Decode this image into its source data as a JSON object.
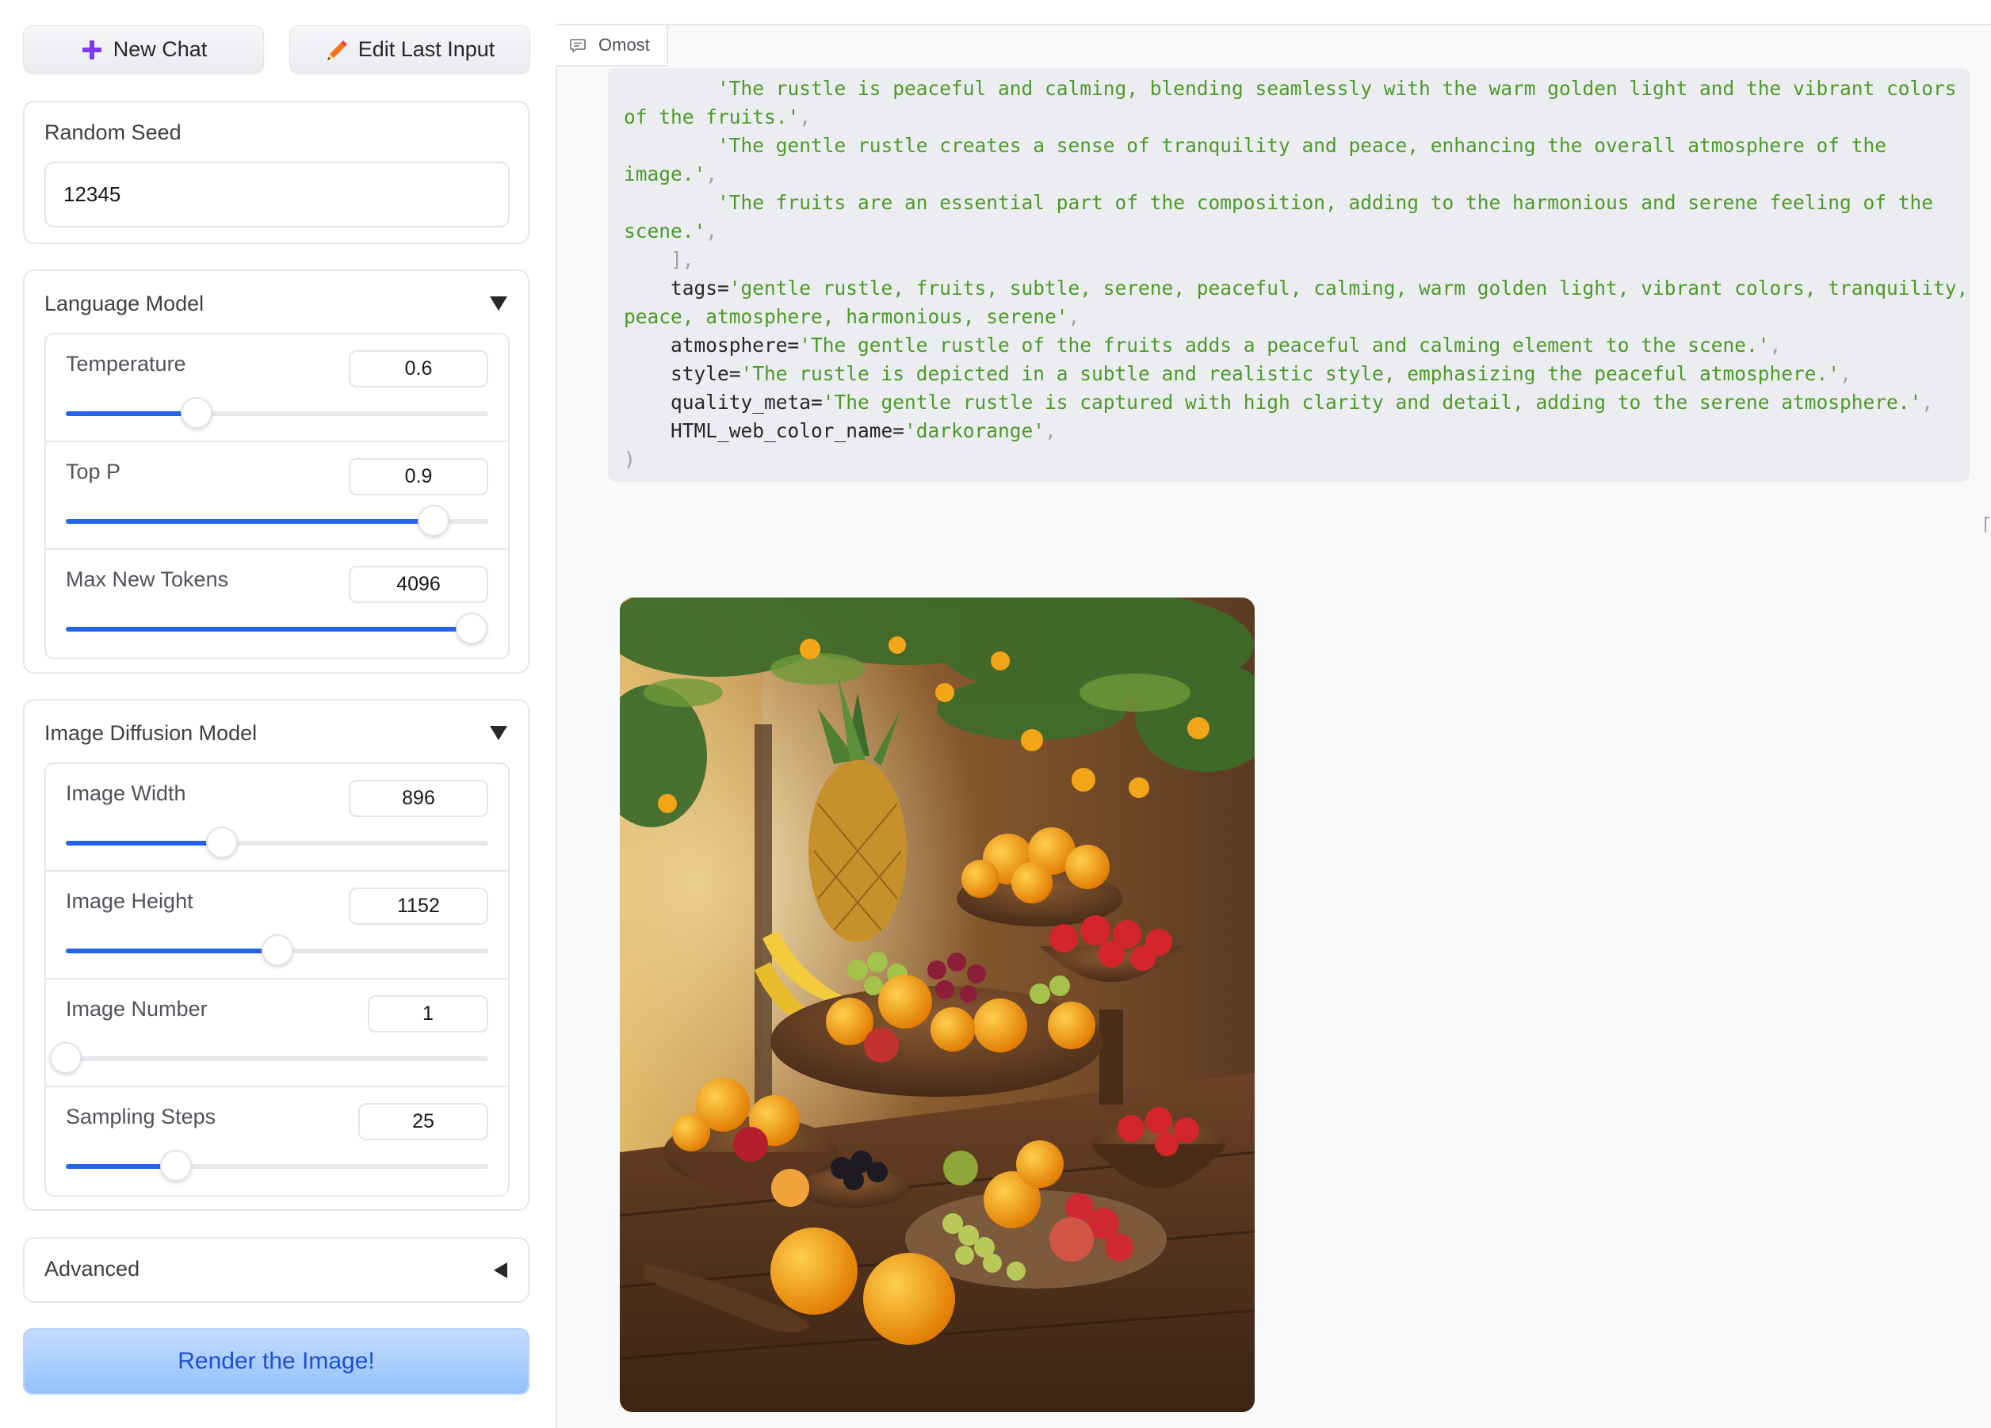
{
  "toolbar": {
    "new_chat_label": "New Chat",
    "new_chat_icon": "plus-icon",
    "edit_last_input_label": "Edit Last Input",
    "edit_last_input_icon": "pencil-icon"
  },
  "random_seed": {
    "label": "Random Seed",
    "value": "12345"
  },
  "language_model": {
    "title": "Language Model",
    "collapse_icon": "triangle-down-icon",
    "sliders": [
      {
        "label": "Temperature",
        "value": "0.6",
        "fraction": 0.31
      },
      {
        "label": "Top P",
        "value": "0.9",
        "fraction": 0.87
      },
      {
        "label": "Max New Tokens",
        "value": "4096",
        "fraction": 0.96
      }
    ]
  },
  "image_diffusion_model": {
    "title": "Image Diffusion Model",
    "collapse_icon": "triangle-down-icon",
    "sliders": [
      {
        "label": "Image Width",
        "value": "896",
        "fraction": 0.37
      },
      {
        "label": "Image Height",
        "value": "1152",
        "fraction": 0.5
      },
      {
        "label": "Image Number",
        "value": "1",
        "fraction": 0.0
      },
      {
        "label": "Sampling Steps",
        "value": "25",
        "fraction": 0.26
      }
    ]
  },
  "advanced": {
    "title": "Advanced",
    "expand_icon": "triangle-left-icon"
  },
  "render_button_label": "Render the Image!",
  "chat": {
    "tab_label": "Omost",
    "tab_icon": "chat-bubble-icon",
    "code_lines": [
      [
        {
          "t": "        ",
          "c": "k"
        },
        {
          "t": "'The rustle is peaceful and calming, blending seamlessly with the warm golden light and the vibrant colors",
          "c": "g"
        }
      ],
      [
        {
          "t": "of the fruits.'",
          "c": "g"
        },
        {
          "t": ",",
          "c": "p"
        }
      ],
      [
        {
          "t": "        ",
          "c": "k"
        },
        {
          "t": "'The gentle rustle creates a sense of tranquility and peace, enhancing the overall atmosphere of the",
          "c": "g"
        }
      ],
      [
        {
          "t": "image.'",
          "c": "g"
        },
        {
          "t": ",",
          "c": "p"
        }
      ],
      [
        {
          "t": "        ",
          "c": "k"
        },
        {
          "t": "'The fruits are an essential part of the composition, adding to the harmonious and serene feeling of the",
          "c": "g"
        }
      ],
      [
        {
          "t": "scene.'",
          "c": "g"
        },
        {
          "t": ",",
          "c": "p"
        }
      ],
      [
        {
          "t": "    ],",
          "c": "p"
        }
      ],
      [
        {
          "t": "    tags=",
          "c": "k"
        },
        {
          "t": "'gentle rustle, fruits, subtle, serene, peaceful, calming, warm golden light, vibrant colors, tranquility,",
          "c": "g"
        }
      ],
      [
        {
          "t": "peace, atmosphere, harmonious, serene'",
          "c": "g"
        },
        {
          "t": ",",
          "c": "p"
        }
      ],
      [
        {
          "t": "    atmosphere=",
          "c": "k"
        },
        {
          "t": "'The gentle rustle of the fruits adds a peaceful and calming element to the scene.'",
          "c": "g"
        },
        {
          "t": ",",
          "c": "p"
        }
      ],
      [
        {
          "t": "    style=",
          "c": "k"
        },
        {
          "t": "'The rustle is depicted in a subtle and realistic style, emphasizing the peaceful atmosphere.'",
          "c": "g"
        },
        {
          "t": ",",
          "c": "p"
        }
      ],
      [
        {
          "t": "    quality_meta=",
          "c": "k"
        },
        {
          "t": "'The gentle rustle is captured with high clarity and detail, adding to the serene atmosphere.'",
          "c": "g"
        },
        {
          "t": ",",
          "c": "p"
        }
      ],
      [
        {
          "t": "    HTML_web_color_name=",
          "c": "k"
        },
        {
          "t": "'darkorange'",
          "c": "g"
        },
        {
          "t": ",",
          "c": "p"
        }
      ],
      [
        {
          "t": ")",
          "c": "p"
        }
      ]
    ],
    "generated_image_icon": "generated-fruit-image"
  },
  "colors": {
    "accent": "#2563eb",
    "render_button_text": "#1d4ed8",
    "code_string": "#4d9a29",
    "code_background": "#ebedf0",
    "chat_background": "#f8f9fa"
  }
}
